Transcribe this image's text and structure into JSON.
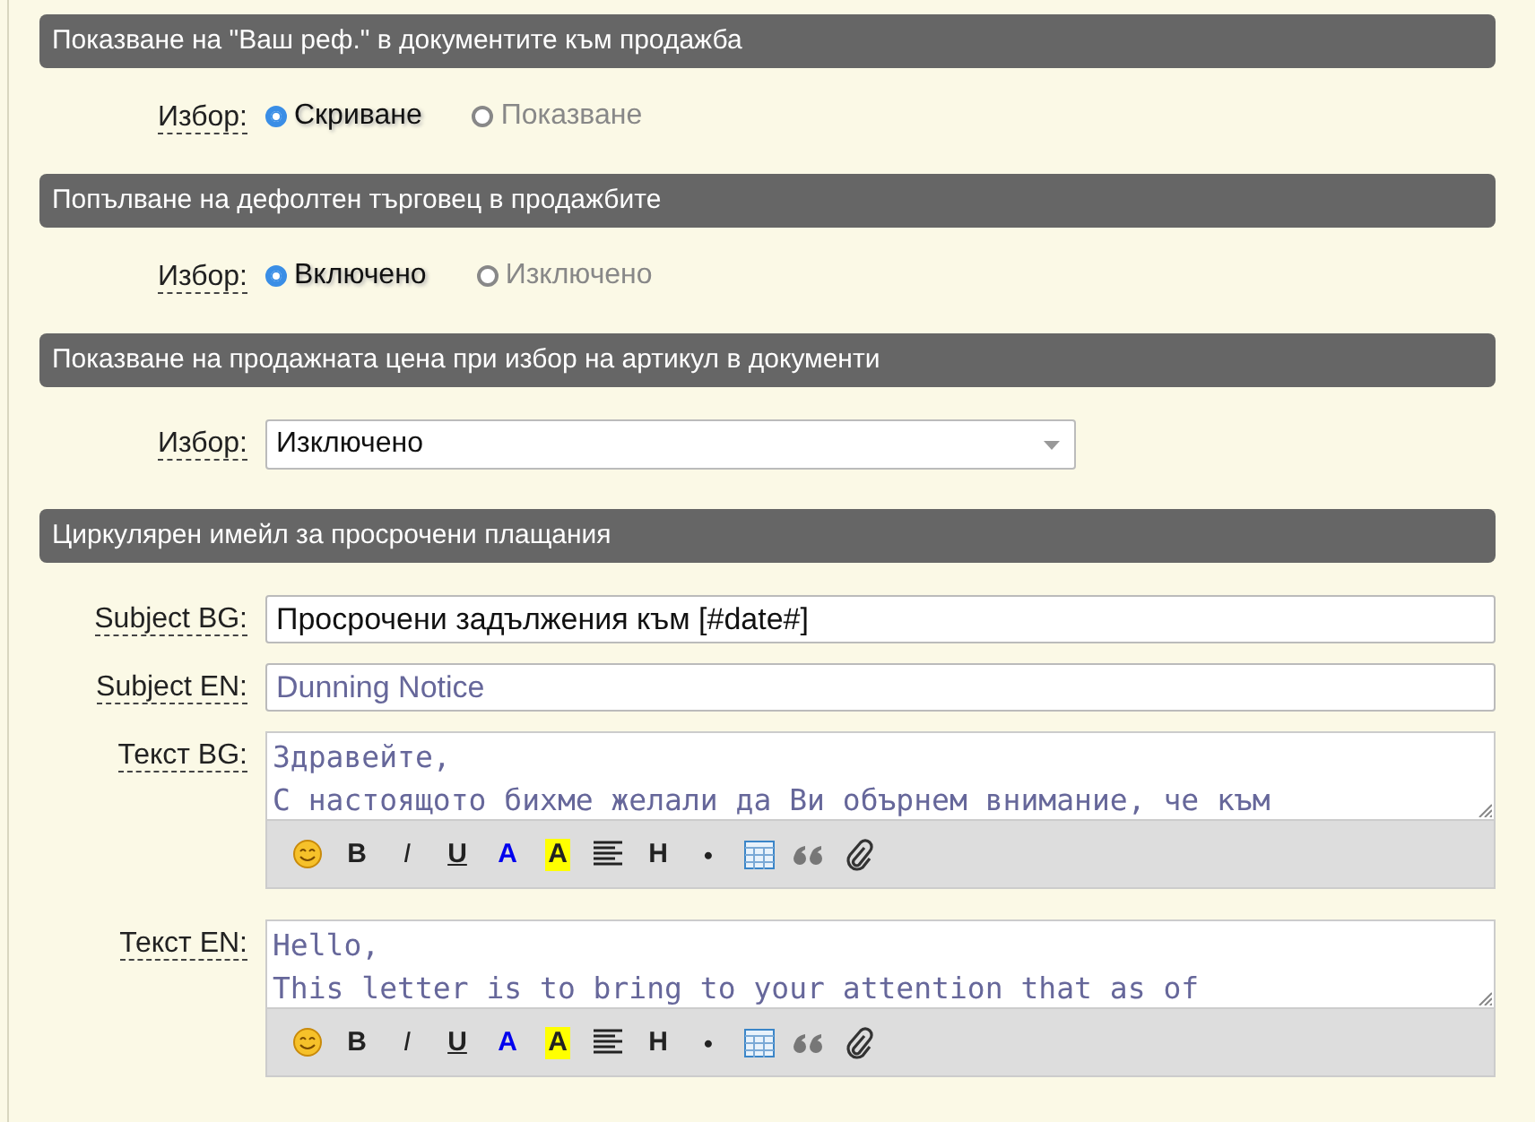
{
  "sections": [
    {
      "title": "Показване на \"Ваш реф.\" в документите към продажба",
      "rows": [
        {
          "kind": "radio",
          "label": "Избор:",
          "options": [
            {
              "label": "Скриване",
              "selected": true
            },
            {
              "label": "Показване",
              "selected": false
            }
          ]
        }
      ]
    },
    {
      "title": "Попълване на дефолтен търговец в продажбите",
      "rows": [
        {
          "kind": "radio",
          "label": "Избор:",
          "options": [
            {
              "label": "Включено",
              "selected": true
            },
            {
              "label": "Изключено",
              "selected": false
            }
          ]
        }
      ]
    },
    {
      "title": "Показване на продажната цена при избор на артикул в документи",
      "rows": [
        {
          "kind": "select",
          "label": "Избор:",
          "value": "Изключено"
        }
      ]
    },
    {
      "title": "Циркулярен имейл за просрочени плащания",
      "rows": [
        {
          "kind": "input",
          "label": "Subject BG:",
          "value": "Просрочени задължения към [#date#]"
        },
        {
          "kind": "input",
          "label": "Subject EN:",
          "placeholder": "Dunning Notice"
        },
        {
          "kind": "textarea",
          "label": "Текст BG:",
          "placeholder": "Здравейте,\nС настоящото бихме желали да Ви обърнем внимание, че към",
          "toolbar": [
            {
              "kind": "smiley"
            },
            {
              "kind": "bold",
              "label": "B"
            },
            {
              "kind": "italic",
              "label": "I"
            },
            {
              "kind": "underline",
              "label": "U"
            },
            {
              "kind": "color",
              "label": "A"
            },
            {
              "kind": "highlight",
              "label": "A"
            },
            {
              "kind": "align"
            },
            {
              "kind": "heading",
              "label": "H"
            },
            {
              "kind": "bullet",
              "label": "•"
            },
            {
              "kind": "table"
            },
            {
              "kind": "quote"
            },
            {
              "kind": "attach"
            }
          ]
        },
        {
          "kind": "textarea",
          "label": "Текст EN:",
          "placeholder": "Hello,\nThis letter is to bring to your attention that as of",
          "toolbar": [
            {
              "kind": "smiley"
            },
            {
              "kind": "bold",
              "label": "B"
            },
            {
              "kind": "italic",
              "label": "I"
            },
            {
              "kind": "underline",
              "label": "U"
            },
            {
              "kind": "color",
              "label": "A"
            },
            {
              "kind": "highlight",
              "label": "A"
            },
            {
              "kind": "align"
            },
            {
              "kind": "heading",
              "label": "H"
            },
            {
              "kind": "bullet",
              "label": "•"
            },
            {
              "kind": "table"
            },
            {
              "kind": "quote"
            },
            {
              "kind": "attach"
            }
          ]
        }
      ]
    }
  ]
}
